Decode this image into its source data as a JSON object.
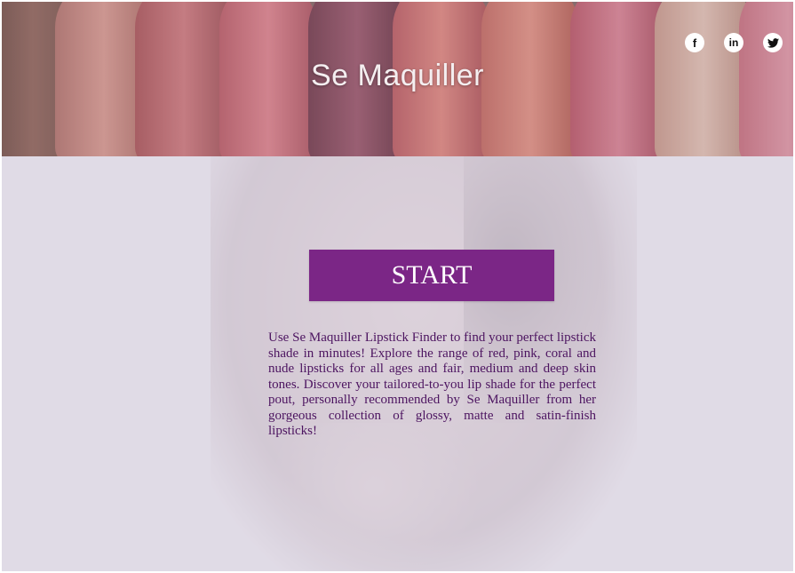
{
  "header": {
    "title": "Se Maquiller",
    "social": [
      {
        "icon": "facebook-icon",
        "glyph": "f"
      },
      {
        "icon": "linkedin-icon",
        "glyph": "in"
      },
      {
        "icon": "twitter-icon",
        "glyph": "❀"
      }
    ]
  },
  "main": {
    "start_label": "START",
    "description": "Use Se Maquiller Lipstick Finder to find your perfect lipstick shade in minutes! Explore the range of red, pink, coral and nude lipsticks for all ages and fair, medium and deep skin tones. Discover your tailored-to-you lip shade for the perfect pout, personally recommended by Se Maquiller from her gorgeous collection of glossy, matte and satin-finish lipsticks!"
  },
  "colors": {
    "accent": "#7b2686",
    "background": "#e0dbe6",
    "text": "#4c1460"
  }
}
